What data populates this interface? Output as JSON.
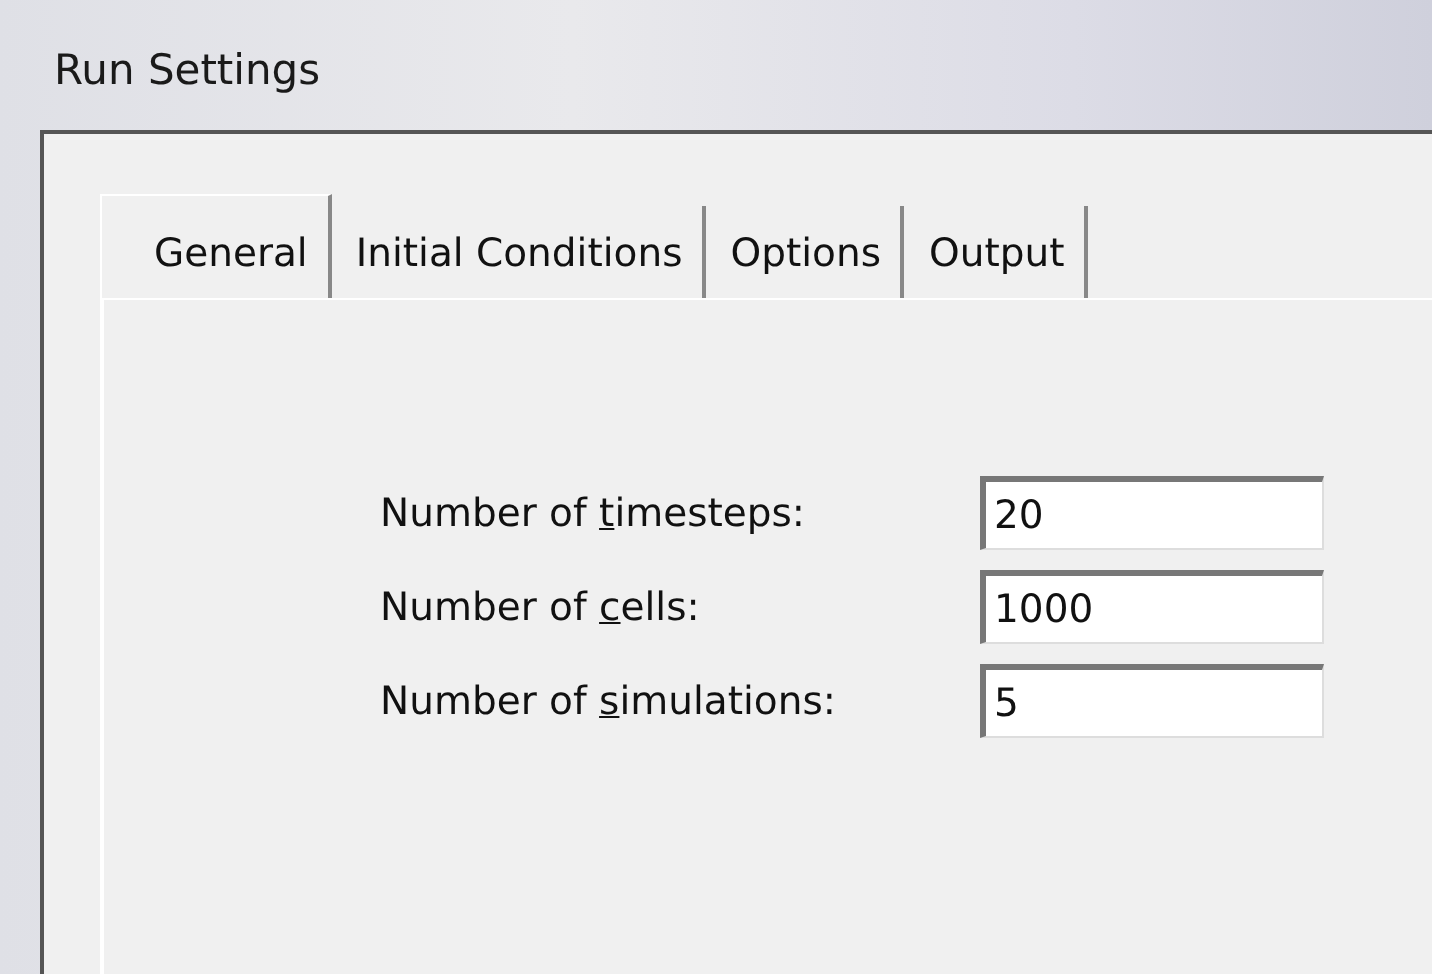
{
  "window": {
    "title": "Run Settings"
  },
  "tabs": [
    {
      "label": "General",
      "selected": true
    },
    {
      "label": "Initial Conditions",
      "selected": false
    },
    {
      "label": "Options",
      "selected": false
    },
    {
      "label": "Output",
      "selected": false
    }
  ],
  "fields": [
    {
      "label_before": "Number of ",
      "access_key": "t",
      "label_after": "imesteps:",
      "value": "20"
    },
    {
      "label_before": "Number of ",
      "access_key": "c",
      "label_after": "ells:",
      "value": "1000"
    },
    {
      "label_before": "Number of ",
      "access_key": "s",
      "label_after": "imulations:",
      "value": "5"
    }
  ]
}
